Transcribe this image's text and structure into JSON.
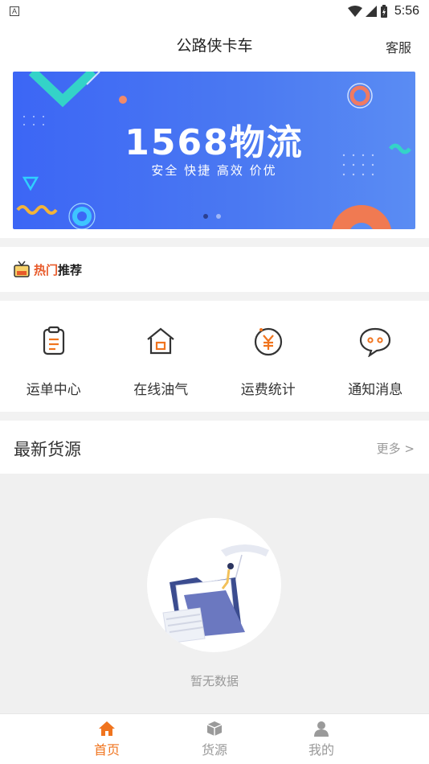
{
  "status_bar": {
    "time": "5:56",
    "left_icon": "A"
  },
  "header": {
    "title": "公路侠卡车",
    "service": "客服"
  },
  "banner": {
    "headline": "1568物流",
    "slogan": "安全 快捷 高效 价优",
    "slide_count": 2,
    "active_slide": 1
  },
  "hot": {
    "label_part1": "热门",
    "label_part2": "推荐"
  },
  "grid": [
    {
      "label": "运单中心",
      "icon": "clipboard-icon"
    },
    {
      "label": "在线油气",
      "icon": "house-icon"
    },
    {
      "label": "运费统计",
      "icon": "yen-icon"
    },
    {
      "label": "通知消息",
      "icon": "chat-icon"
    }
  ],
  "latest": {
    "title": "最新货源",
    "more": "更多 >"
  },
  "empty": {
    "message": "暂无数据"
  },
  "tabs": [
    {
      "label": "首页",
      "icon": "home-icon",
      "active": true
    },
    {
      "label": "货源",
      "icon": "box-icon",
      "active": false
    },
    {
      "label": "我的",
      "icon": "user-icon",
      "active": false
    }
  ],
  "colors": {
    "accent": "#f0741e",
    "inactive": "#999999",
    "banner_blue": "#3c66f5"
  }
}
